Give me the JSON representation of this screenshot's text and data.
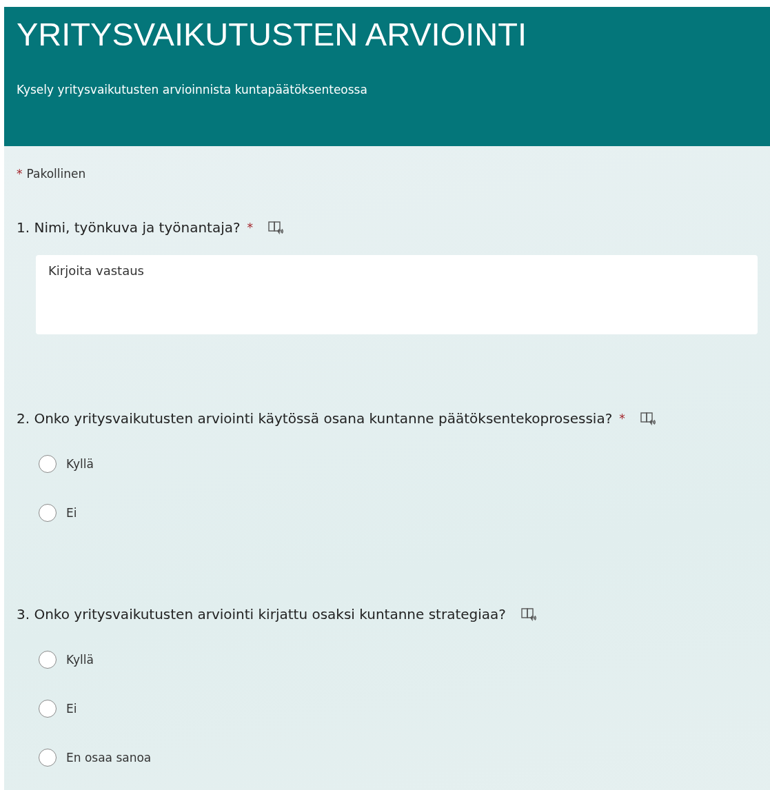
{
  "header": {
    "title": "YRITYSVAIKUTUSTEN ARVIOINTI",
    "subtitle": "Kysely yritysvaikutusten arvioinnista kuntapäätöksenteossa"
  },
  "required_note": {
    "mark": "*",
    "text": "Pakollinen"
  },
  "questions": [
    {
      "kind": "text",
      "title": "1. Nimi, työnkuva ja työnantaja?",
      "required": true,
      "placeholder": "Kirjoita vastaus"
    },
    {
      "kind": "choice",
      "title": "2. Onko yritysvaikutusten arviointi käytössä osana kuntanne päätöksentekoprosessia?",
      "required": true,
      "options": [
        {
          "label": "Kyllä",
          "selected": false
        },
        {
          "label": "Ei",
          "selected": false
        }
      ]
    },
    {
      "kind": "choice",
      "title": "3. Onko yritysvaikutusten arviointi kirjattu osaksi kuntanne strategiaa?",
      "required": false,
      "options": [
        {
          "label": "Kyllä",
          "selected": false
        },
        {
          "label": "Ei",
          "selected": false
        },
        {
          "label": "En osaa sanoa",
          "selected": false
        }
      ]
    }
  ]
}
